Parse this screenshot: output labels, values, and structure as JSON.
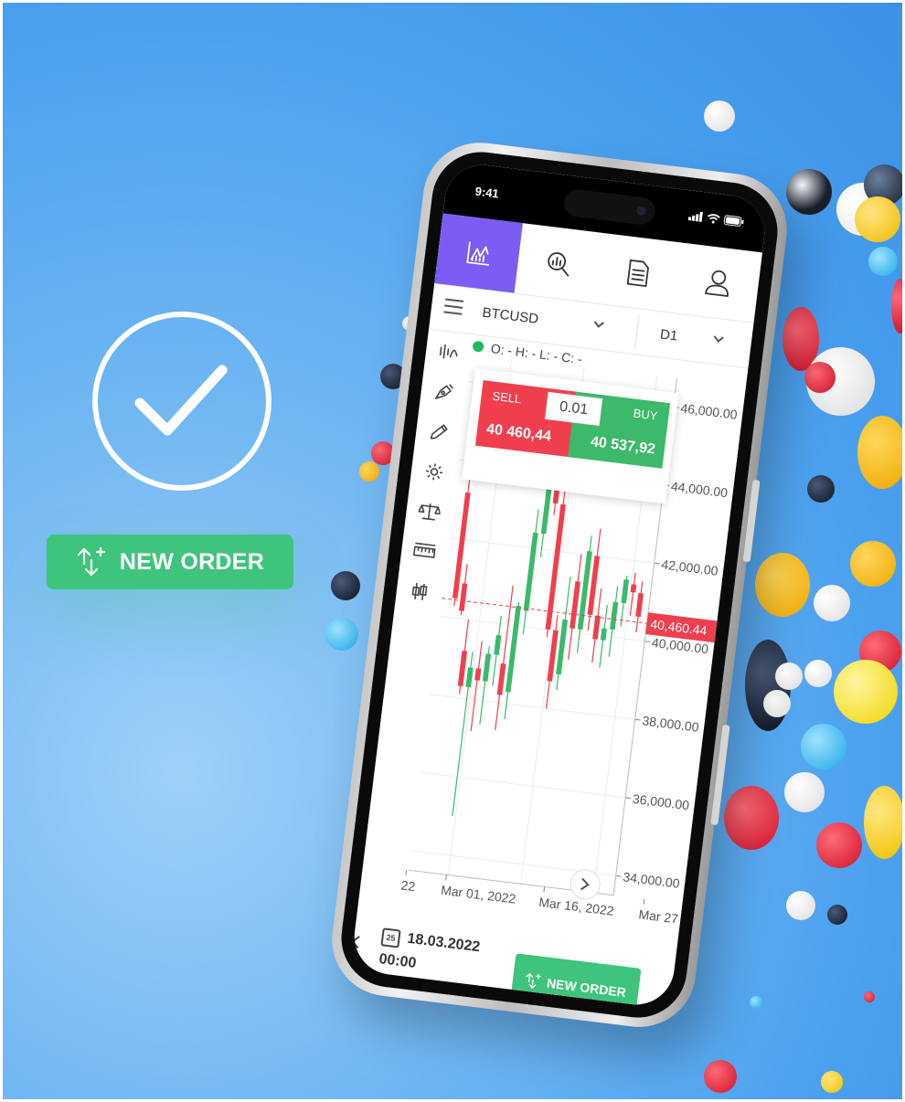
{
  "left_panel": {
    "new_order_label": "NEW ORDER"
  },
  "phone": {
    "status_time": "9:41",
    "symbol": "BTCUSD",
    "timeframe": "D1",
    "ohlc_text": "O: - H: - L: - C: -",
    "trade": {
      "sell_label": "SELL",
      "sell_price": "40 460,44",
      "quantity": "0.01",
      "buy_label": "BUY",
      "buy_price": "40 537,92"
    },
    "price_axis": [
      "46,000.00",
      "44,000.00",
      "42,000.00",
      "40,000.00",
      "38,000.00",
      "36,000.00",
      "34,000.00"
    ],
    "current_price": "40,460.44",
    "date_axis": [
      "22",
      "Mar 01, 2022",
      "Mar 16, 2022",
      "Mar 27"
    ],
    "date_icon_day": "25",
    "selected_date": "18.03.2022",
    "selected_time": "00:00",
    "new_order_label": "NEW ORDER"
  },
  "colors": {
    "accent": "#7c5cf4",
    "buy": "#3cb96a",
    "sell": "#ef3f4e",
    "order_button": "#3ec47c"
  },
  "chart_data": {
    "type": "candlestick",
    "symbol": "BTCUSD",
    "timeframe": "D1",
    "ylim": [
      33500,
      46500
    ],
    "current_price": 40460.44,
    "candles": [
      {
        "o": 43200,
        "h": 45000,
        "l": 40300,
        "c": 40500
      },
      {
        "o": 40900,
        "h": 41400,
        "l": 40100,
        "c": 40200
      },
      {
        "o": 39200,
        "h": 40000,
        "l": 38100,
        "c": 38300
      },
      {
        "o": 38300,
        "h": 39200,
        "l": 35000,
        "c": 38800
      },
      {
        "o": 38800,
        "h": 39500,
        "l": 37200,
        "c": 38500
      },
      {
        "o": 38500,
        "h": 39400,
        "l": 37400,
        "c": 39200
      },
      {
        "o": 39200,
        "h": 40200,
        "l": 38400,
        "c": 39700
      },
      {
        "o": 39000,
        "h": 41000,
        "l": 37300,
        "c": 38200
      },
      {
        "o": 38300,
        "h": 40600,
        "l": 37600,
        "c": 40500
      },
      {
        "o": 40400,
        "h": 43000,
        "l": 39800,
        "c": 42400
      },
      {
        "o": 42400,
        "h": 44800,
        "l": 41800,
        "c": 44200
      },
      {
        "o": 44300,
        "h": 44800,
        "l": 42900,
        "c": 43200
      },
      {
        "o": 43200,
        "h": 43800,
        "l": 39800,
        "c": 40000
      },
      {
        "o": 40000,
        "h": 40400,
        "l": 38000,
        "c": 38700
      },
      {
        "o": 38900,
        "h": 41400,
        "l": 38500,
        "c": 40300
      },
      {
        "o": 41300,
        "h": 42000,
        "l": 39300,
        "c": 40100
      },
      {
        "o": 40100,
        "h": 42500,
        "l": 39500,
        "c": 42100
      },
      {
        "o": 42000,
        "h": 42700,
        "l": 40100,
        "c": 40500
      },
      {
        "o": 40500,
        "h": 41200,
        "l": 39300,
        "c": 39900
      },
      {
        "o": 39900,
        "h": 40800,
        "l": 39200,
        "c": 40200
      },
      {
        "o": 40200,
        "h": 41300,
        "l": 39500,
        "c": 40900
      },
      {
        "o": 40900,
        "h": 41600,
        "l": 40300,
        "c": 41500
      },
      {
        "o": 41400,
        "h": 41700,
        "l": 40600,
        "c": 41200
      },
      {
        "o": 41200,
        "h": 41500,
        "l": 40200,
        "c": 40600
      }
    ]
  }
}
